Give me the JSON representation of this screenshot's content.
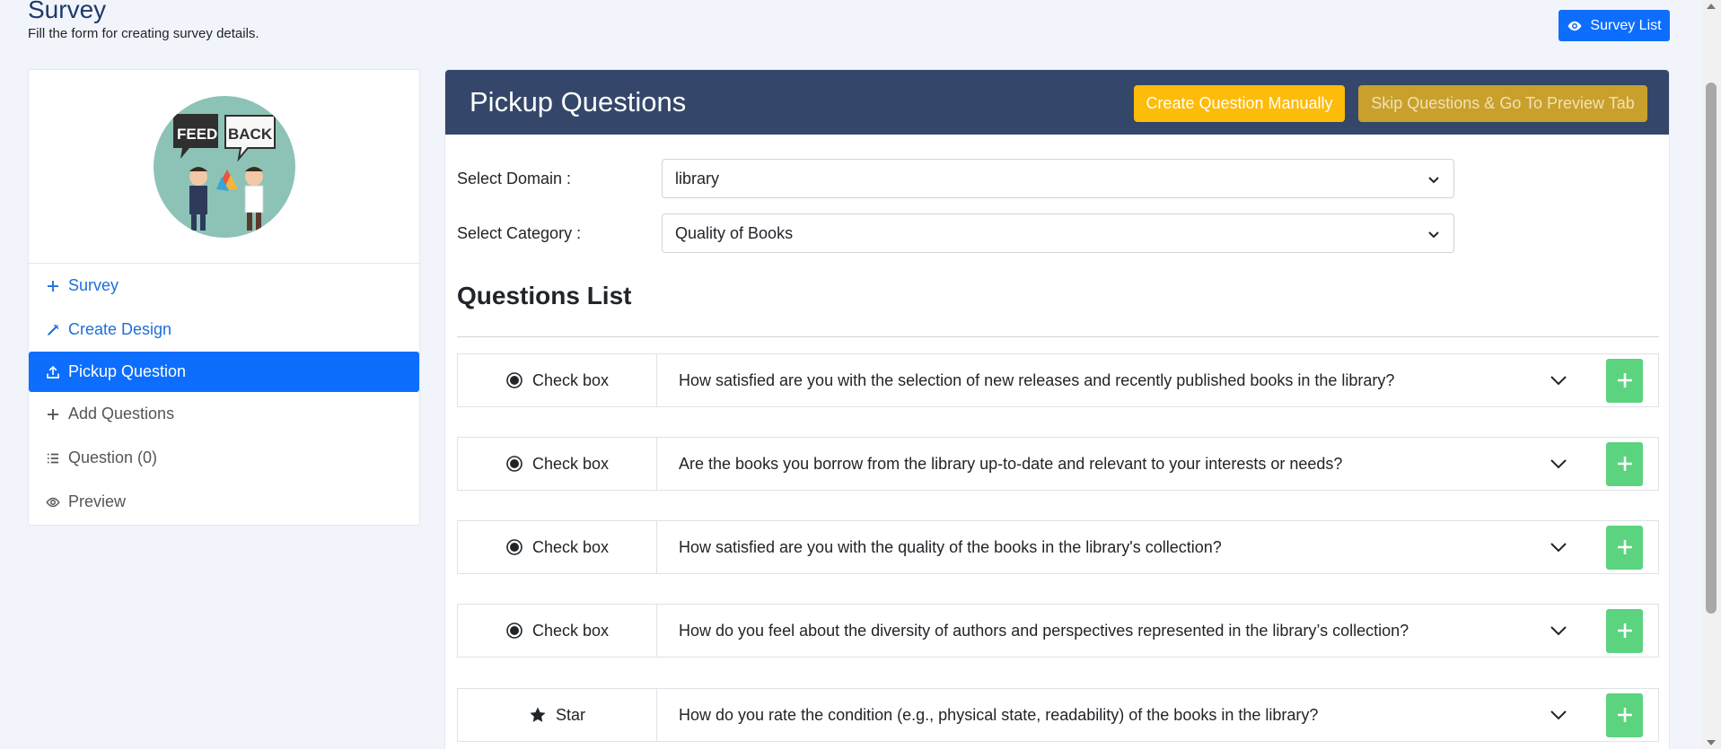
{
  "page": {
    "title": "Survey",
    "subtitle": "Fill the form for creating survey details."
  },
  "header_actions": {
    "survey_list_label": "Survey List",
    "survey_list_icon": "eye-icon"
  },
  "sidebar": {
    "logo": {
      "text_left": "FEED",
      "text_right": "BACK",
      "icon": "feedback-logo"
    },
    "items": [
      {
        "label": "Survey",
        "icon": "plus-icon",
        "state": "link"
      },
      {
        "label": "Create Design",
        "icon": "pen-icon",
        "state": "link"
      },
      {
        "label": "Pickup Question",
        "icon": "upload-icon",
        "state": "active"
      },
      {
        "label": "Add Questions",
        "icon": "plus-icon",
        "state": "normal"
      },
      {
        "label": "Question (0)",
        "icon": "list-icon",
        "state": "normal"
      },
      {
        "label": "Preview",
        "icon": "eye-icon",
        "state": "normal"
      }
    ]
  },
  "panel": {
    "title": "Pickup Questions",
    "create_button": "Create Question Manually",
    "skip_button": "Skip Questions & Go To Preview Tab",
    "domain": {
      "label": "Select Domain :",
      "value": "library"
    },
    "category": {
      "label": "Select Category :",
      "value": "Quality of Books"
    },
    "list_title": "Questions List",
    "questions": [
      {
        "type": "Check box",
        "type_icon": "radio-icon",
        "text": "How satisfied are you with the selection of new releases and recently published books in the library?"
      },
      {
        "type": "Check box",
        "type_icon": "radio-icon",
        "text": "Are the books you borrow from the library up-to-date and relevant to your interests or needs?"
      },
      {
        "type": "Check box",
        "type_icon": "radio-icon",
        "text": "How satisfied are you with the quality of the books in the library's collection?"
      },
      {
        "type": "Check box",
        "type_icon": "radio-icon",
        "text": "How do you feel about the diversity of authors and perspectives represented in the library’s collection?"
      },
      {
        "type": "Star",
        "type_icon": "star-icon",
        "text": "How do you rate the condition (e.g., physical state, readability) of the books in the library?"
      }
    ]
  },
  "colors": {
    "primary": "#0d6efd",
    "header": "#34476a",
    "warning": "#fdbb0a",
    "skip": "#c9a02c",
    "add": "#5bd37f",
    "title": "#1d3a6b"
  }
}
